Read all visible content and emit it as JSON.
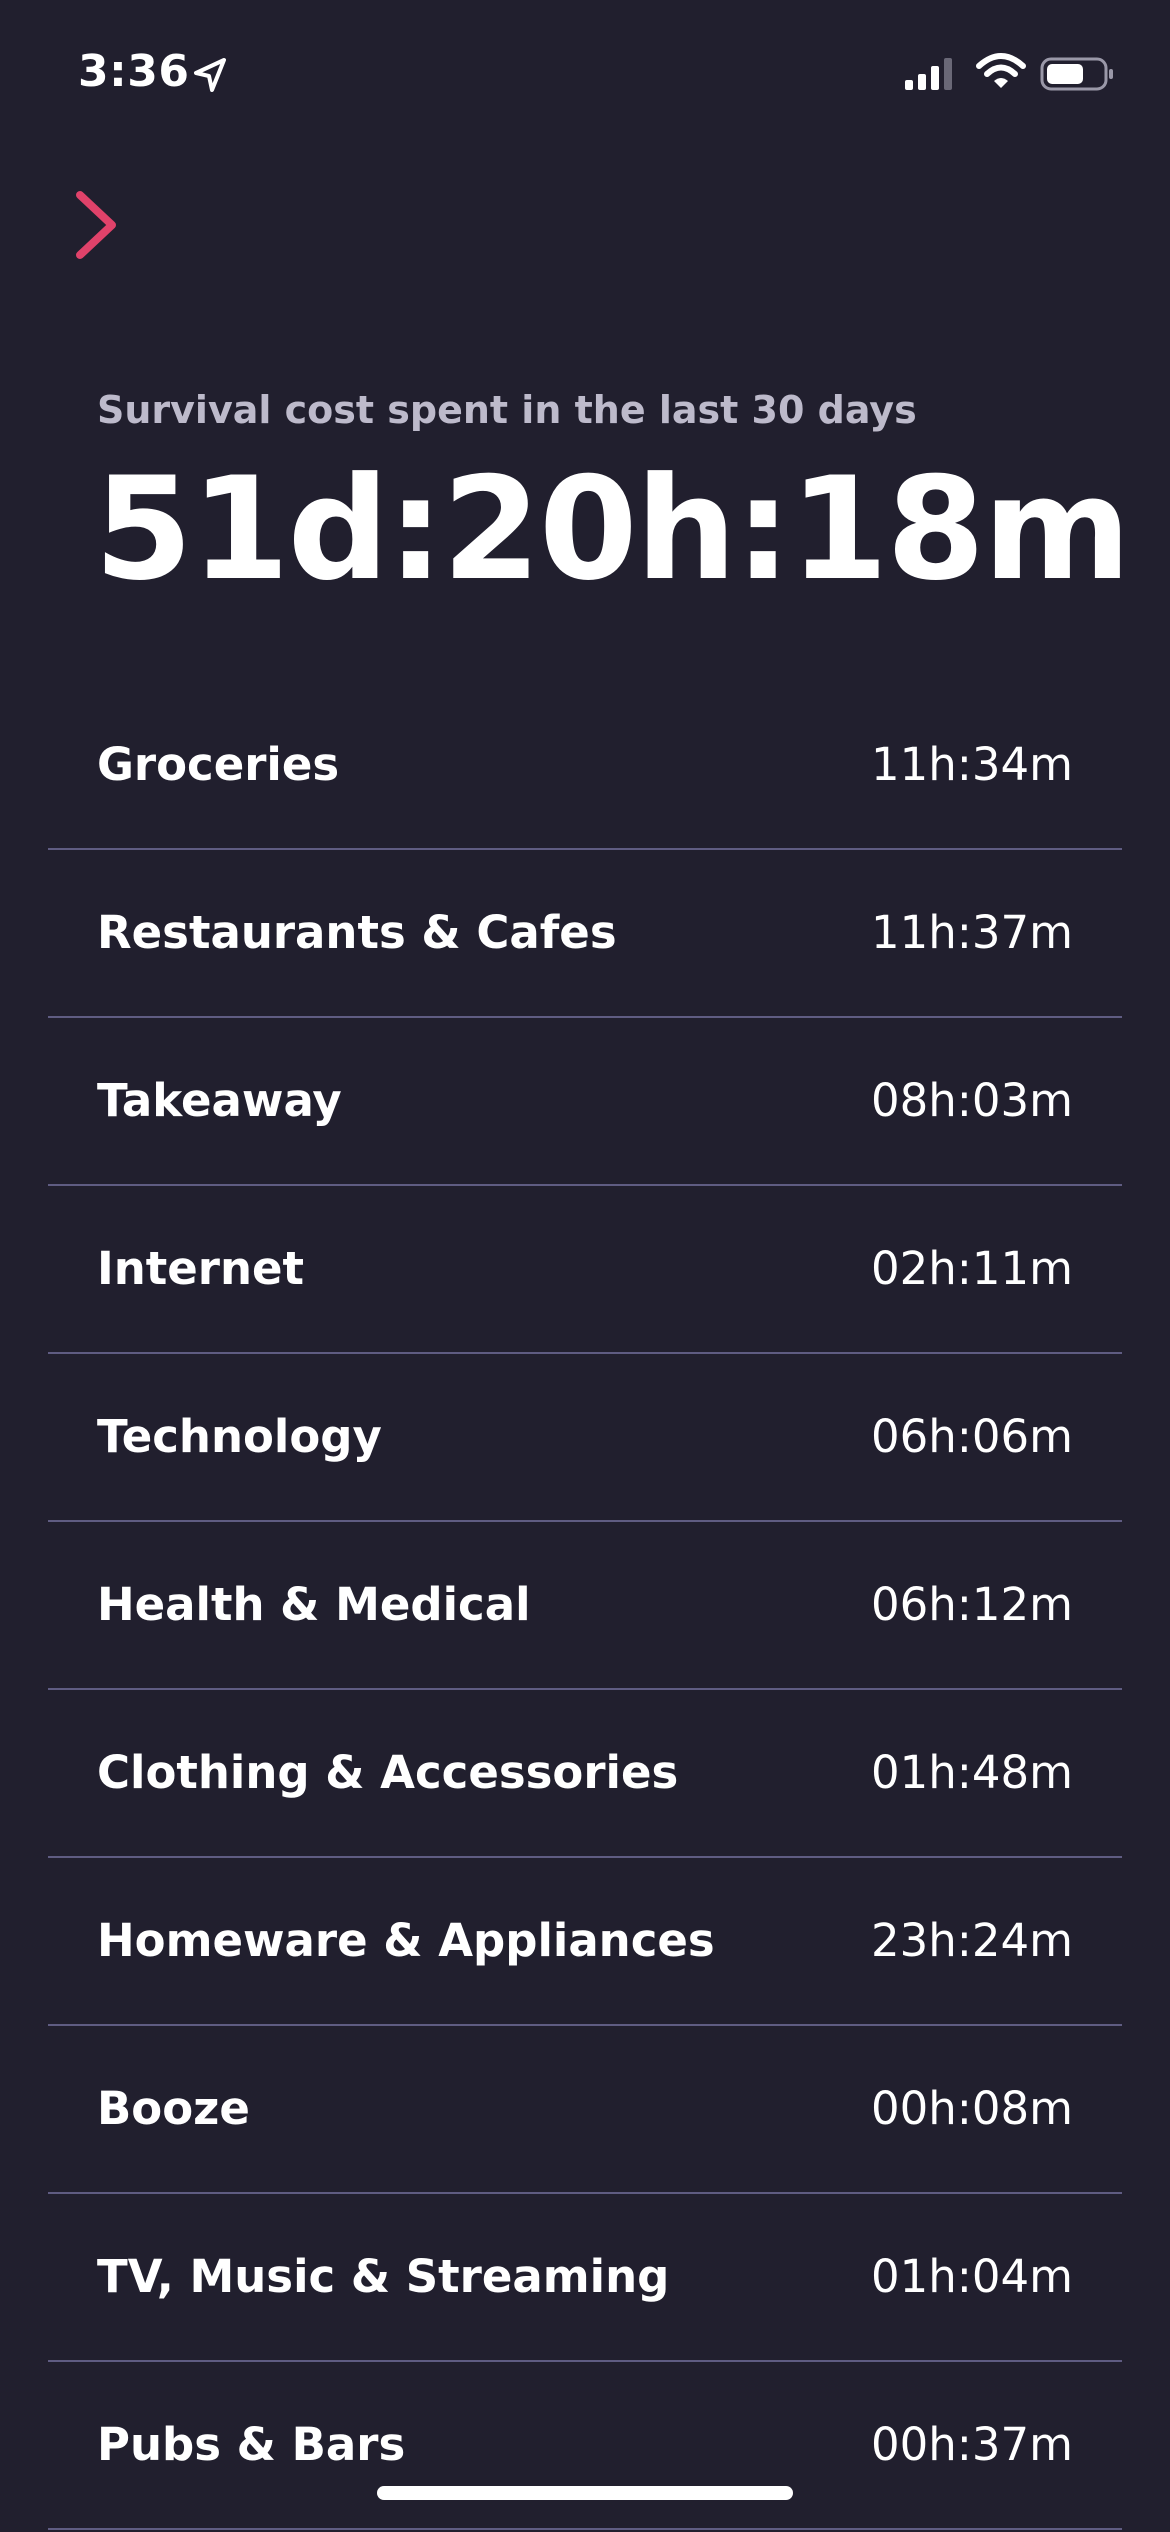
{
  "status_bar": {
    "time": "3:36"
  },
  "header": {
    "back_icon": "chevron-right-icon",
    "accent_color": "#e0426a"
  },
  "summary": {
    "subtitle": "Survival cost spent in the last 30 days",
    "total": "51d:20h:18m"
  },
  "categories": [
    {
      "label": "Groceries",
      "value": "11h:34m"
    },
    {
      "label": "Restaurants & Cafes",
      "value": "11h:37m"
    },
    {
      "label": "Takeaway",
      "value": "08h:03m"
    },
    {
      "label": "Internet",
      "value": "02h:11m"
    },
    {
      "label": "Technology",
      "value": "06h:06m"
    },
    {
      "label": "Health & Medical",
      "value": "06h:12m"
    },
    {
      "label": "Clothing & Accessories",
      "value": "01h:48m"
    },
    {
      "label": "Homeware & Appliances",
      "value": "23h:24m"
    },
    {
      "label": "Booze",
      "value": "00h:08m"
    },
    {
      "label": "TV, Music & Streaming",
      "value": "01h:04m"
    },
    {
      "label": "Pubs & Bars",
      "value": "00h:37m"
    }
  ],
  "colors": {
    "background": "#211f2e",
    "divider": "#5f5c82",
    "subtitle": "#bdbacb"
  }
}
